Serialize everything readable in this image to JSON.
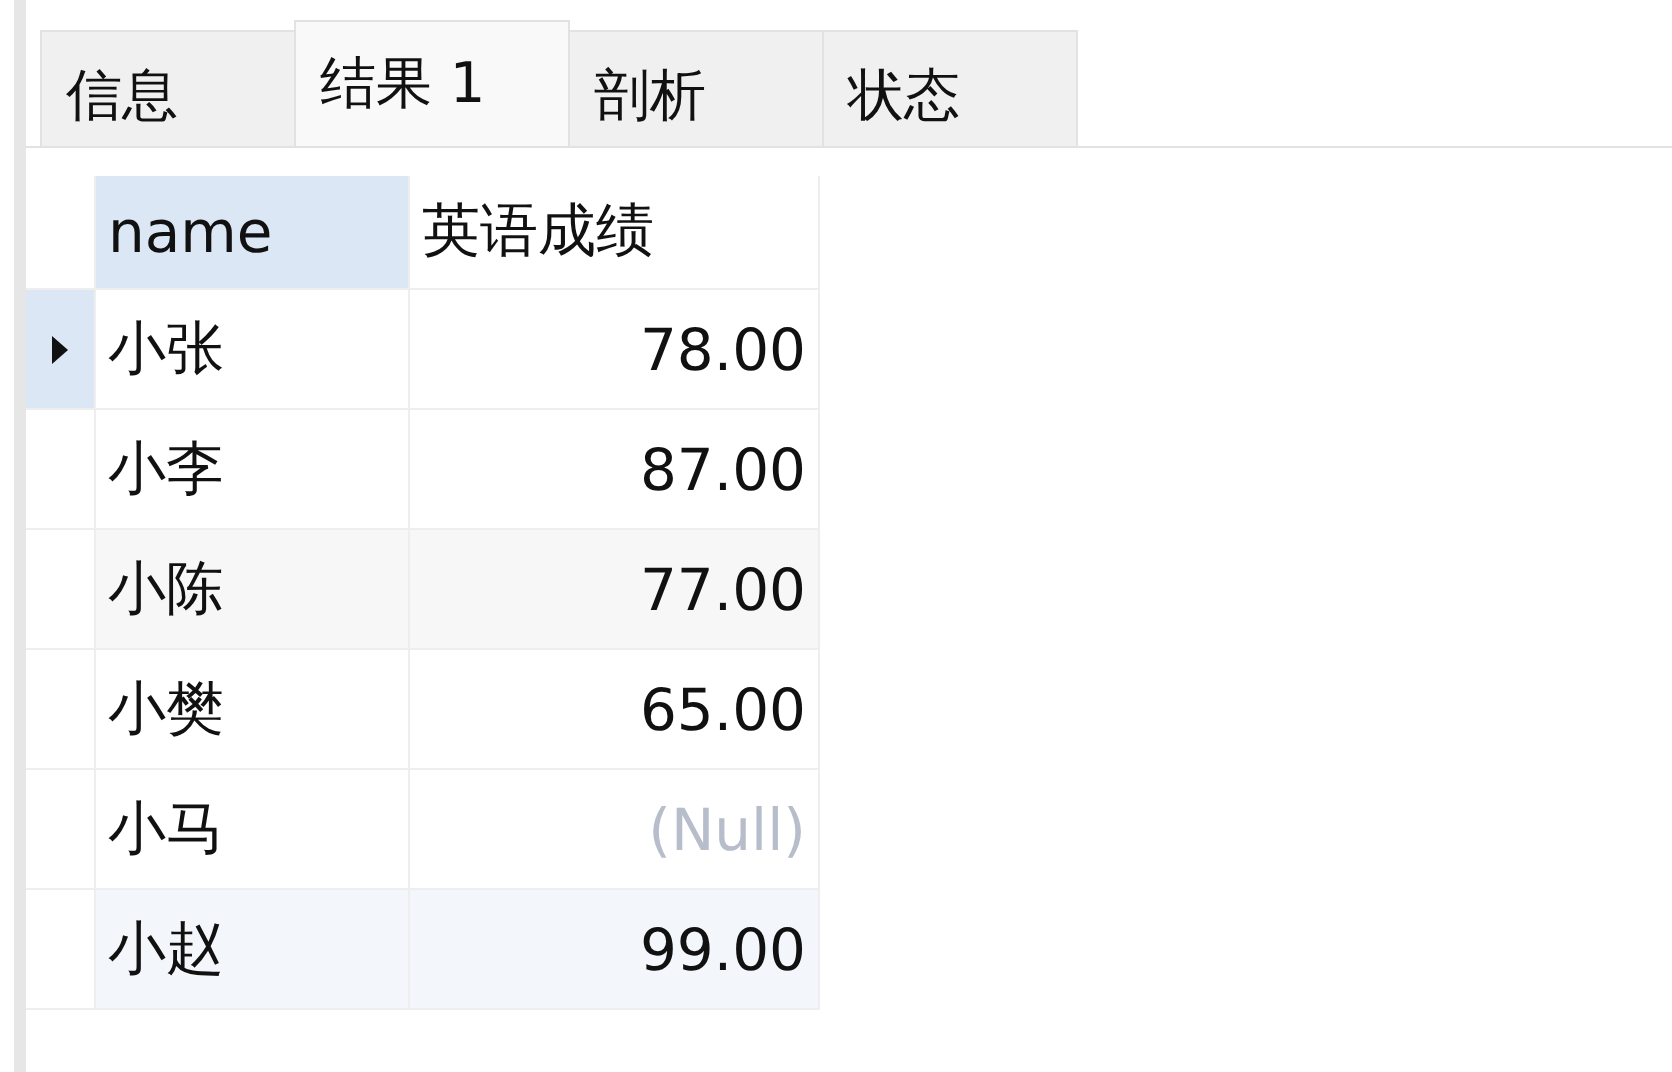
{
  "tabs": [
    {
      "label": "信息",
      "selected": false
    },
    {
      "label": "结果 1",
      "selected": true
    },
    {
      "label": "剖析",
      "selected": false
    },
    {
      "label": "状态",
      "selected": false
    }
  ],
  "table": {
    "columns": [
      {
        "label": "name",
        "selected": true
      },
      {
        "label": "英语成绩",
        "selected": false
      }
    ],
    "rows": [
      {
        "selected": true,
        "cells": [
          {
            "kind": "text",
            "value": "小张"
          },
          {
            "kind": "number",
            "value": "78.00"
          }
        ]
      },
      {
        "selected": false,
        "cells": [
          {
            "kind": "text",
            "value": "小李"
          },
          {
            "kind": "number",
            "value": "87.00"
          }
        ]
      },
      {
        "selected": false,
        "cells": [
          {
            "kind": "text",
            "value": "小陈"
          },
          {
            "kind": "number",
            "value": "77.00"
          }
        ]
      },
      {
        "selected": false,
        "cells": [
          {
            "kind": "text",
            "value": "小樊"
          },
          {
            "kind": "number",
            "value": "65.00"
          }
        ]
      },
      {
        "selected": false,
        "cells": [
          {
            "kind": "text",
            "value": "小马"
          },
          {
            "kind": "null",
            "value": "(Null)"
          }
        ]
      },
      {
        "selected": false,
        "cells": [
          {
            "kind": "text",
            "value": "小赵"
          },
          {
            "kind": "number",
            "value": "99.00"
          }
        ]
      }
    ]
  }
}
